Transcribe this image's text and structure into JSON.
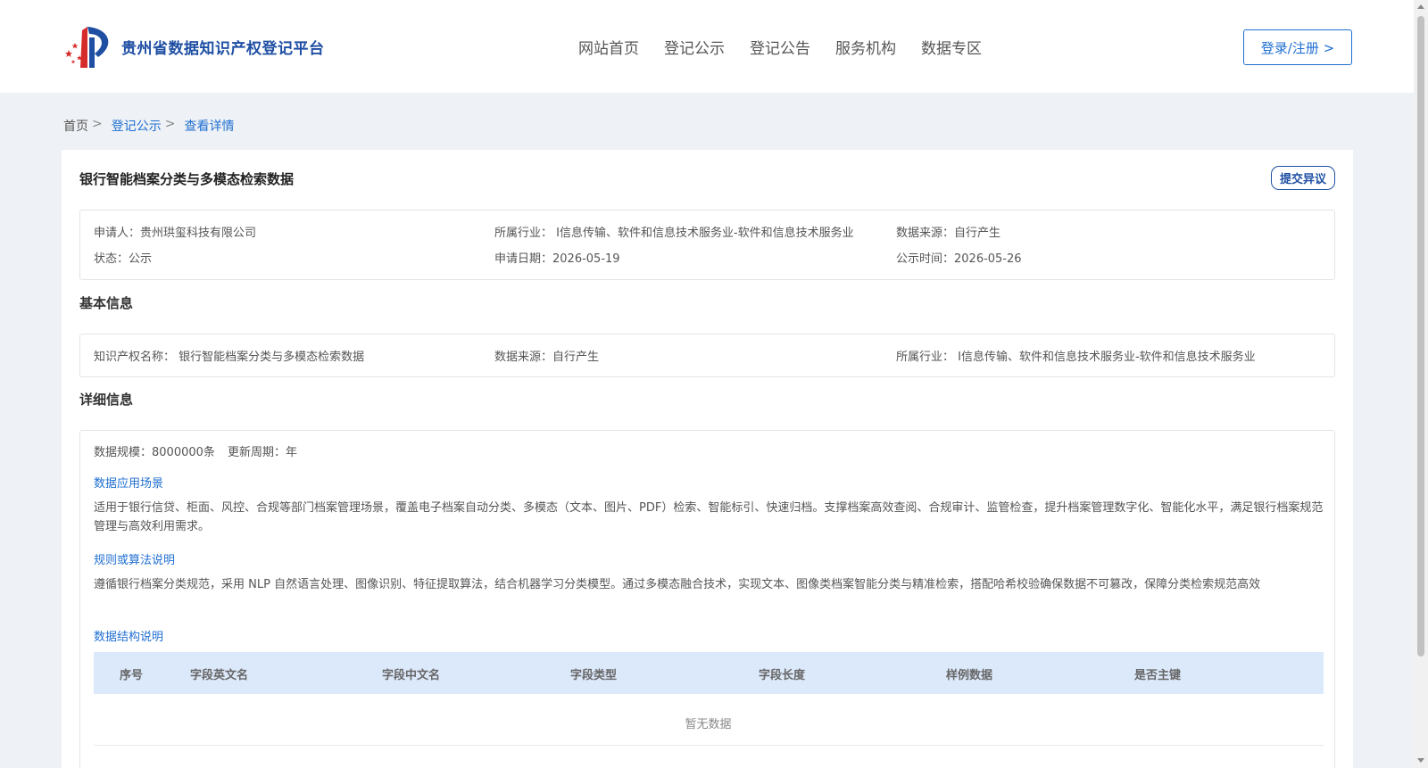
{
  "brand": {
    "name": "贵州省数据知识产权登记平台"
  },
  "nav": {
    "items": [
      "网站首页",
      "登记公示",
      "登记公告",
      "服务机构",
      "数据专区"
    ]
  },
  "login_label": "登录/注册 >",
  "breadcrumb": {
    "home": "首页",
    "sep": ">",
    "list": "登记公示",
    "current": "查看详情"
  },
  "record": {
    "title": "银行智能档案分类与多模态检索数据",
    "objection_label": "提交异议",
    "summary": {
      "applicant": "申请人：贵州珙玺科技有限公司",
      "industry": "所属行业： I信息传输、软件和信息技术服务业-软件和信息技术服务业",
      "source": "数据来源：自行产生",
      "status": "状态：公示",
      "apply_date": "申请日期：2026-05-19",
      "publish_date": "公示时间：2026-05-26"
    }
  },
  "basic": {
    "title": "基本信息",
    "ip_name": "知识产权名称： 银行智能档案分类与多模态检索数据",
    "source": "数据来源：自行产生",
    "industry": "所属行业： I信息传输、软件和信息技术服务业-软件和信息技术服务业"
  },
  "detail": {
    "title": "详细信息",
    "scale": "数据规模：8000000条",
    "cycle": "更新周期：年",
    "scenario_title": "数据应用场景",
    "scenario_text": "适用于银行信贷、柜面、风控、合规等部门档案管理场景，覆盖电子档案自动分类、多模态（文本、图片、PDF）检索、智能标引、快速归档。支撑档案高效查阅、合规审计、监管检查，提升档案管理数字化、智能化水平，满足银行档案规范管理与高效利用需求。",
    "rule_title": "规则或算法说明",
    "rule_text": "遵循银行档案分类规范，采用 NLP 自然语言处理、图像识别、特征提取算法，结合机器学习分类模型。通过多模态融合技术，实现文本、图像类档案智能分类与精准检索，搭配哈希校验确保数据不可篡改，保障分类检索规范高效",
    "structure_title": "数据结构说明",
    "table_headers": [
      "序号",
      "字段英文名",
      "字段中文名",
      "字段类型",
      "字段长度",
      "样例数据",
      "是否主键"
    ],
    "empty_text": "暂无数据"
  },
  "colors": {
    "accent": "#1f6fd1",
    "brand": "#1f4fa3",
    "table_head_bg": "#dce9fb"
  }
}
